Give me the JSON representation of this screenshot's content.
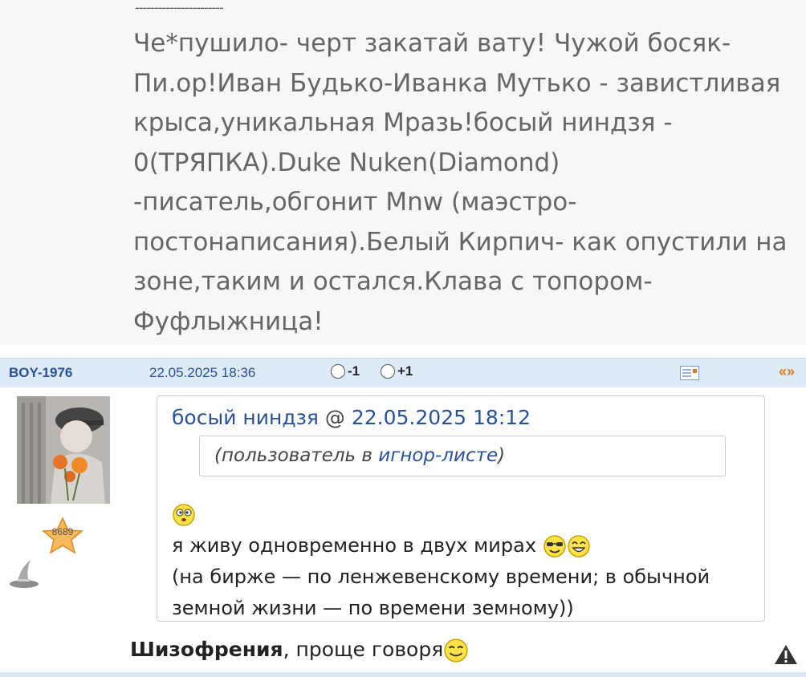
{
  "previous_post": {
    "separator": "-----------------------",
    "lines": [
      "Че*пушило- черт закатай вату! Чужой босяк-",
      "Пи.ор!Иван Будько-Иванка Мутько - завистливая",
      "крыса,уникальная Мразь!босый ниндзя -",
      "0(ТРЯПКА).Duke Nuken(Diamond)",
      "-писатель,обгонит Mnw (маэстро-",
      "постонаписания).Белый Кирпич- как опустили на",
      "зоне,таким и остался.Клава с топором-",
      "Фуфлыжница!"
    ]
  },
  "post": {
    "author": "BOY-1976",
    "date": "22.05.2025 18:36",
    "vote_minus": "-1",
    "vote_plus": "+1",
    "quote_link": "«»",
    "rating": "8689",
    "quote": {
      "author": "босый ниндзя",
      "at": "@",
      "date": "22.05.2025 18:12",
      "ignore_prefix": "(пользователь в ",
      "ignore_link": "игнор-листе",
      "ignore_suffix": ")",
      "line1": "я живу одновременно в двух мирах",
      "line2": "(на бирже — по ленжевенскому времени; в обычной",
      "line3": "земной жизни — по времени земному))"
    },
    "reply_bold": "Шизофрения",
    "reply_text": ", проще говоря"
  },
  "icons": [
    "message-icon",
    "warning-icon",
    "star-badge-icon",
    "wizard-hat-icon",
    "smiley-icon"
  ],
  "colors": {
    "link": "#2a5196",
    "accent": "#e07818",
    "header_bg": "#ddeaf8"
  }
}
